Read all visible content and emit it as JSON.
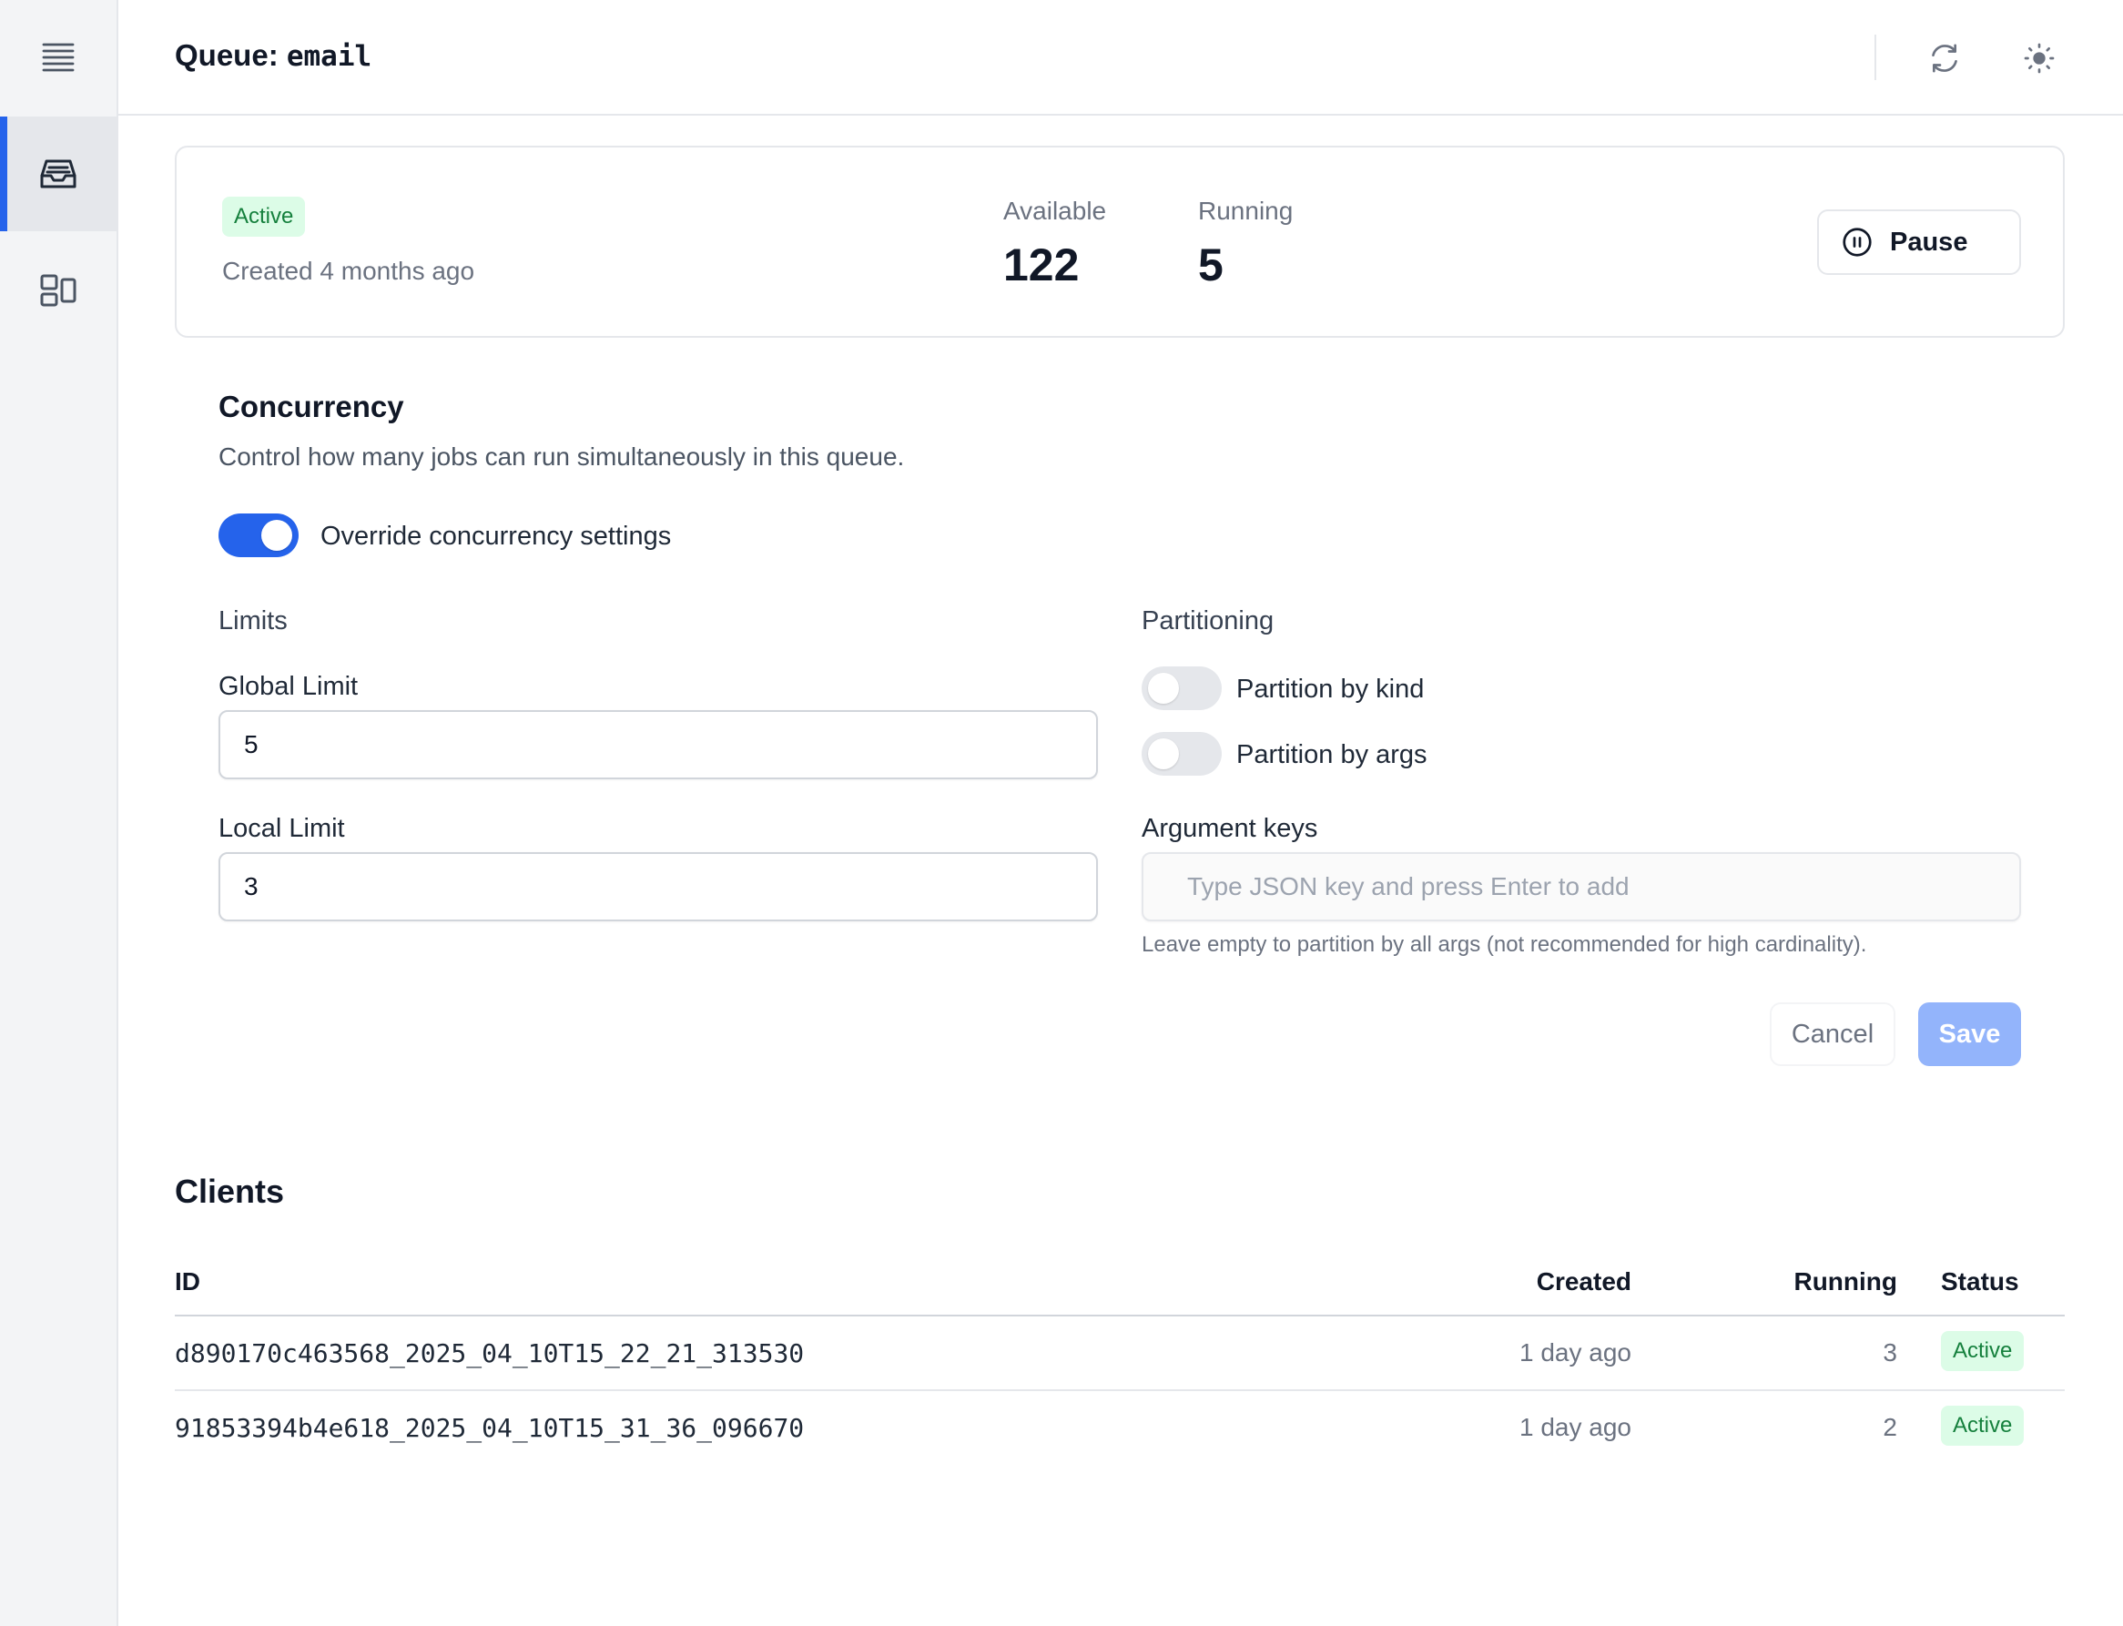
{
  "header": {
    "title_prefix": "Queue: ",
    "queue_name": "email",
    "refresh_icon": "refresh-icon",
    "theme_icon": "sun-icon"
  },
  "sidebar": {
    "items": [
      {
        "icon": "list-icon",
        "active": false
      },
      {
        "icon": "inbox-icon",
        "active": true
      },
      {
        "icon": "layout-icon",
        "active": false
      }
    ]
  },
  "queue": {
    "status": "Active",
    "created": "Created 4 months ago",
    "available_label": "Available",
    "available_value": "122",
    "running_label": "Running",
    "running_value": "5",
    "pause_label": "Pause"
  },
  "concurrency": {
    "title": "Concurrency",
    "description": "Control how many jobs can run simultaneously in this queue.",
    "override_label": "Override concurrency settings",
    "override_on": true,
    "limits_heading": "Limits",
    "global_limit_label": "Global Limit",
    "global_limit_value": "5",
    "local_limit_label": "Local Limit",
    "local_limit_value": "3",
    "partitioning_heading": "Partitioning",
    "partition_by_kind_label": "Partition by kind",
    "partition_by_kind_on": false,
    "partition_by_args_label": "Partition by args",
    "partition_by_args_on": false,
    "argument_keys_label": "Argument keys",
    "argument_keys_placeholder": "Type JSON key and press Enter to add",
    "argument_keys_help": "Leave empty to partition by all args (not recommended for high cardinality).",
    "cancel_label": "Cancel",
    "save_label": "Save"
  },
  "clients": {
    "title": "Clients",
    "columns": {
      "id": "ID",
      "created": "Created",
      "running": "Running",
      "status": "Status"
    },
    "rows": [
      {
        "id": "d890170c463568_2025_04_10T15_22_21_313530",
        "created": "1 day ago",
        "running": "3",
        "status": "Active"
      },
      {
        "id": "91853394b4e618_2025_04_10T15_31_36_096670",
        "created": "1 day ago",
        "running": "2",
        "status": "Active"
      }
    ]
  },
  "colors": {
    "accent": "#2563eb",
    "badge_bg": "#dcfce7",
    "badge_text": "#15803d",
    "save_disabled": "#93b4fb"
  }
}
